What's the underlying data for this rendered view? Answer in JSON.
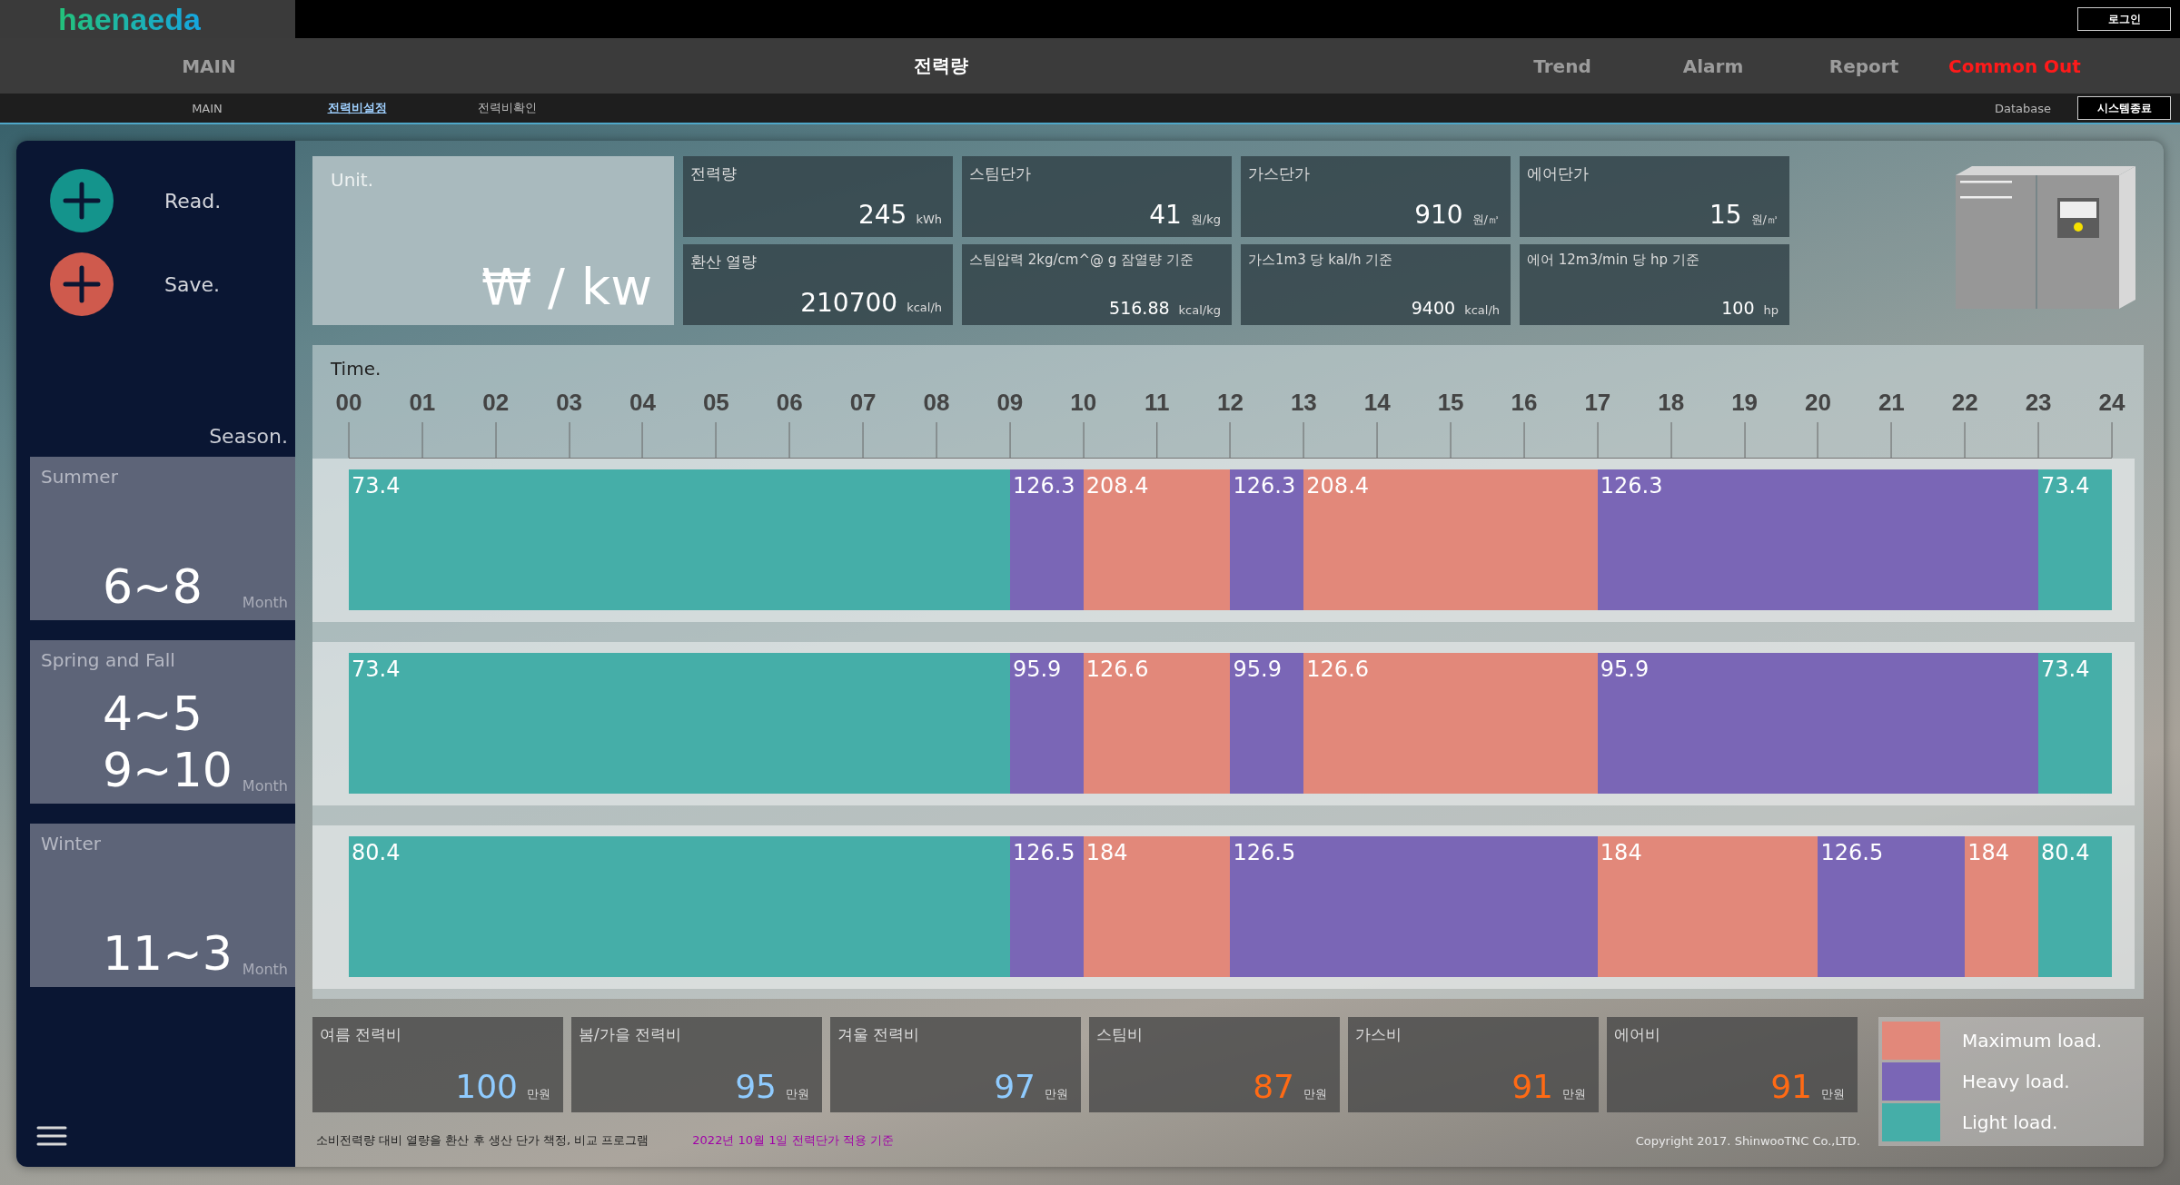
{
  "header": {
    "logo": "haenaeda",
    "login": "로그인",
    "nav": [
      {
        "label": "MAIN",
        "selected": false,
        "alert": false
      },
      {
        "label": "전력량",
        "selected": true,
        "alert": false
      },
      {
        "label": "Trend",
        "selected": false,
        "alert": false
      },
      {
        "label": "Alarm",
        "selected": false,
        "alert": false
      },
      {
        "label": "Report",
        "selected": false,
        "alert": false
      },
      {
        "label": "Common Out",
        "selected": false,
        "alert": true
      }
    ],
    "subnav": [
      {
        "label": "MAIN",
        "selected": false
      },
      {
        "label": "전력비설정",
        "selected": true
      },
      {
        "label": "전력비확인",
        "selected": false
      }
    ],
    "database": "Database",
    "exit": "시스템종료"
  },
  "sidebar": {
    "actions": [
      {
        "label": "Read.",
        "kind": "read"
      },
      {
        "label": "Save.",
        "kind": "save"
      }
    ],
    "season_label": "Season.",
    "seasons": [
      {
        "name": "Summer",
        "months": [
          "6~8"
        ],
        "unit": "Month"
      },
      {
        "name": "Spring and Fall",
        "months": [
          "4~5",
          "9~10"
        ],
        "unit": "Month"
      },
      {
        "name": "Winter",
        "months": [
          "11~3"
        ],
        "unit": "Month"
      }
    ]
  },
  "unit": {
    "label": "Unit.",
    "value": "₩ / kw"
  },
  "rates": [
    {
      "title": "전력량",
      "value": "245",
      "unit": "kWh"
    },
    {
      "title": "스팀단가",
      "value": "41",
      "unit": "원/kg"
    },
    {
      "title": "가스단가",
      "value": "910",
      "unit": "원/㎥"
    },
    {
      "title": "에어단가",
      "value": "15",
      "unit": "원/㎥"
    },
    {
      "title": "환산 열량",
      "value": "210700",
      "unit": "kcal/h"
    },
    {
      "title": "스팀압력 2kg/cm^@ g 잠열량 기준",
      "value": "516.88",
      "unit": "kcal/kg"
    },
    {
      "title": "가스1m3 당 kal/h 기준",
      "value": "9400",
      "unit": "kcal/h"
    },
    {
      "title": "에어 12m3/min 당 hp 기준",
      "value": "100",
      "unit": "hp"
    }
  ],
  "timeline": {
    "label": "Time.",
    "ticks": [
      "00",
      "01",
      "02",
      "03",
      "04",
      "05",
      "06",
      "07",
      "08",
      "09",
      "10",
      "11",
      "12",
      "13",
      "14",
      "15",
      "16",
      "17",
      "18",
      "19",
      "20",
      "21",
      "22",
      "23",
      "24"
    ],
    "rows": [
      {
        "hours": [
          {
            "kind": "light",
            "value": "73.4"
          },
          {
            "kind": "light"
          },
          {
            "kind": "light"
          },
          {
            "kind": "light"
          },
          {
            "kind": "light"
          },
          {
            "kind": "light"
          },
          {
            "kind": "light"
          },
          {
            "kind": "light"
          },
          {
            "kind": "light"
          },
          {
            "kind": "heavy",
            "value": "126.3"
          },
          {
            "kind": "maximum",
            "value": "208.4"
          },
          {
            "kind": "maximum"
          },
          {
            "kind": "heavy",
            "value": "126.3"
          },
          {
            "kind": "maximum",
            "value": "208.4"
          },
          {
            "kind": "maximum"
          },
          {
            "kind": "maximum"
          },
          {
            "kind": "maximum"
          },
          {
            "kind": "heavy",
            "value": "126.3"
          },
          {
            "kind": "heavy"
          },
          {
            "kind": "heavy"
          },
          {
            "kind": "heavy"
          },
          {
            "kind": "heavy"
          },
          {
            "kind": "heavy"
          },
          {
            "kind": "light",
            "value": "73.4"
          }
        ]
      },
      {
        "hours": [
          {
            "kind": "light",
            "value": "73.4"
          },
          {
            "kind": "light"
          },
          {
            "kind": "light"
          },
          {
            "kind": "light"
          },
          {
            "kind": "light"
          },
          {
            "kind": "light"
          },
          {
            "kind": "light"
          },
          {
            "kind": "light"
          },
          {
            "kind": "light"
          },
          {
            "kind": "heavy",
            "value": "95.9"
          },
          {
            "kind": "maximum",
            "value": "126.6"
          },
          {
            "kind": "maximum"
          },
          {
            "kind": "heavy",
            "value": "95.9"
          },
          {
            "kind": "maximum",
            "value": "126.6"
          },
          {
            "kind": "maximum"
          },
          {
            "kind": "maximum"
          },
          {
            "kind": "maximum"
          },
          {
            "kind": "heavy",
            "value": "95.9"
          },
          {
            "kind": "heavy"
          },
          {
            "kind": "heavy"
          },
          {
            "kind": "heavy"
          },
          {
            "kind": "heavy"
          },
          {
            "kind": "heavy"
          },
          {
            "kind": "light",
            "value": "73.4"
          }
        ]
      },
      {
        "hours": [
          {
            "kind": "light",
            "value": "80.4"
          },
          {
            "kind": "light"
          },
          {
            "kind": "light"
          },
          {
            "kind": "light"
          },
          {
            "kind": "light"
          },
          {
            "kind": "light"
          },
          {
            "kind": "light"
          },
          {
            "kind": "light"
          },
          {
            "kind": "light"
          },
          {
            "kind": "heavy",
            "value": "126.5"
          },
          {
            "kind": "maximum",
            "value": "184"
          },
          {
            "kind": "maximum"
          },
          {
            "kind": "heavy",
            "value": "126.5"
          },
          {
            "kind": "heavy"
          },
          {
            "kind": "heavy"
          },
          {
            "kind": "heavy"
          },
          {
            "kind": "heavy"
          },
          {
            "kind": "maximum",
            "value": "184"
          },
          {
            "kind": "maximum"
          },
          {
            "kind": "maximum"
          },
          {
            "kind": "heavy",
            "value": "126.5"
          },
          {
            "kind": "heavy"
          },
          {
            "kind": "maximum",
            "value": "184"
          },
          {
            "kind": "light",
            "value": "80.4"
          }
        ]
      }
    ]
  },
  "costs": [
    {
      "title": "여름 전력비",
      "value": "100",
      "unit": "만원",
      "kind": "power"
    },
    {
      "title": "봄/가을 전력비",
      "value": "95",
      "unit": "만원",
      "kind": "power"
    },
    {
      "title": "겨울 전력비",
      "value": "97",
      "unit": "만원",
      "kind": "power"
    },
    {
      "title": "스팀비",
      "value": "87",
      "unit": "만원",
      "kind": "utility"
    },
    {
      "title": "가스비",
      "value": "91",
      "unit": "만원",
      "kind": "utility"
    },
    {
      "title": "에어비",
      "value": "91",
      "unit": "만원",
      "kind": "utility"
    }
  ],
  "legend": [
    {
      "kind": "maximum",
      "label": "Maximum load.",
      "color": "#e2887a"
    },
    {
      "kind": "heavy",
      "label": "Heavy load.",
      "color": "#7a66b6"
    },
    {
      "kind": "light",
      "label": "Light load.",
      "color": "#45aea8"
    }
  ],
  "footer": {
    "description": "소비전력량 대비 열량을 환산 후 생산 단가 책정, 비교 프로그램",
    "notice": "2022년 10월 1일 전력단가 적용 기준",
    "copyright": "Copyright 2017. ShinwooTNC Co.,LTD."
  }
}
